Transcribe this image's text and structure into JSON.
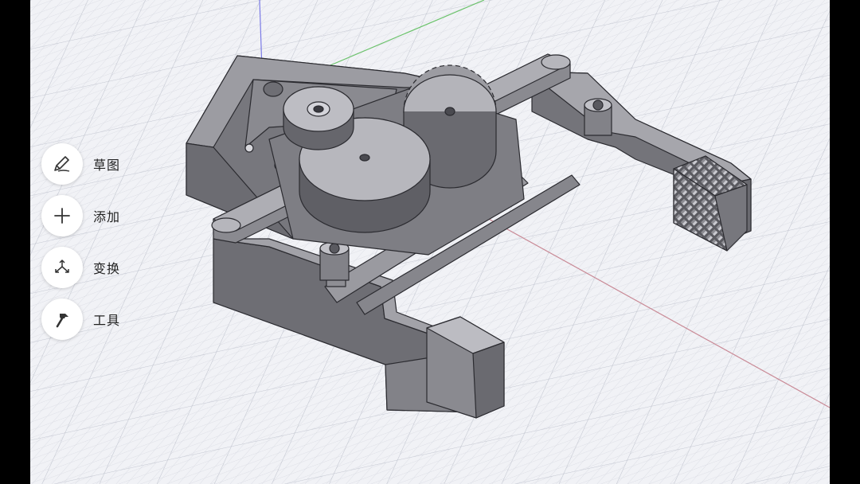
{
  "toolbar": {
    "items": [
      {
        "label": "草图",
        "icon": "sketch-pencil-icon"
      },
      {
        "label": "添加",
        "icon": "plus-icon"
      },
      {
        "label": "变换",
        "icon": "transform-icon"
      },
      {
        "label": "工具",
        "icon": "hammer-icon"
      }
    ]
  },
  "viewport": {
    "background": "#f1f2f6",
    "grid_color": "#c9ccd6",
    "axis_x_color": "#c76b7a",
    "axis_y_color": "#5fbf5f",
    "axis_z_color": "#6f6fe0",
    "model_color": "#8a8a90"
  }
}
